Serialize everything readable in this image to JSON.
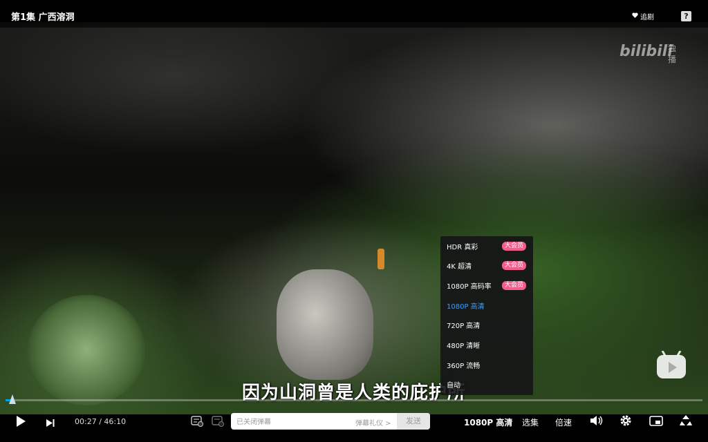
{
  "header": {
    "episode_title": "第1集  广西溶洞",
    "follow_label": "追剧",
    "help_label": "?"
  },
  "watermark": {
    "logo": "bilibili",
    "tag": "独播"
  },
  "subtitle": "因为山洞曾是人类的庇护所",
  "quality_menu": {
    "items": [
      {
        "label": "HDR 真彩",
        "badge": "大会员",
        "active": false
      },
      {
        "label": "4K 超清",
        "badge": "大会员",
        "active": false
      },
      {
        "label": "1080P 高码率",
        "badge": "大会员",
        "active": false
      },
      {
        "label": "1080P 高清",
        "badge": "",
        "active": true
      },
      {
        "label": "720P 高清",
        "badge": "",
        "active": false
      },
      {
        "label": "480P 清晰",
        "badge": "",
        "active": false
      },
      {
        "label": "360P 流畅",
        "badge": "",
        "active": false
      },
      {
        "label": "自动",
        "badge": "",
        "active": false
      }
    ]
  },
  "player": {
    "current_time": "00:27",
    "separator": "/",
    "duration": "46:10",
    "progress_fraction": 0.01,
    "danmaku_placeholder": "已关闭弹幕",
    "etiquette_label": "弹幕礼仪 >",
    "send_label": "发送",
    "quality_label": "1080P 高清",
    "episodes_label": "选集",
    "speed_label": "倍速"
  },
  "colors": {
    "accent": "#00a1d6",
    "active_quality": "#3aa0ff",
    "vip_badge": "#f25d8e"
  }
}
